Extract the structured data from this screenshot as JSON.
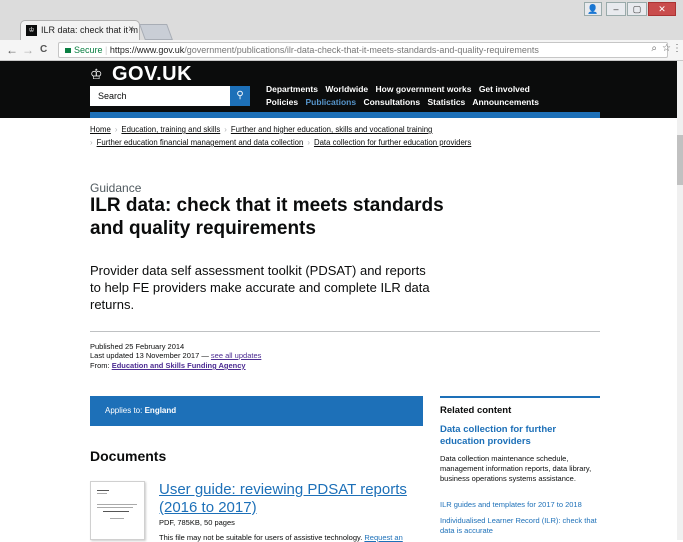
{
  "browser": {
    "tab_title": "ILR data: check that it m",
    "tab_close": "×",
    "favicon": "♔",
    "secure_label": "Secure",
    "url_host": "https://www.gov.uk",
    "url_path": "/government/publications/ilr-data-check-that-it-meets-standards-and-quality-requirements",
    "back": "←",
    "forward": "→",
    "reload": "C",
    "zoom_icon": "⌕",
    "star_icon": "☆",
    "menu_icon": "⋮",
    "win_user": "👤",
    "win_min": "–",
    "win_max": "▢",
    "win_close": "✕"
  },
  "header": {
    "crown": "♔",
    "logo": "GOV.UK",
    "search_placeholder": "Search",
    "search_icon": "🔍",
    "nav_row1": [
      "Departments",
      "Worldwide",
      "How government works",
      "Get involved"
    ],
    "nav_row2": [
      "Policies",
      "Publications",
      "Consultations",
      "Statistics",
      "Announcements"
    ],
    "active_nav": "Publications"
  },
  "breadcrumbs": {
    "row1": [
      "Home",
      "Education, training and skills",
      "Further and higher education, skills and vocational training"
    ],
    "row2": [
      "Further education financial management and data collection",
      "Data collection for further education providers"
    ],
    "separator": "›"
  },
  "page": {
    "label": "Guidance",
    "title": "ILR data: check that it meets standards and quality requirements",
    "summary": "Provider data self assessment toolkit (PDSAT) and reports to help FE providers make accurate and complete ILR data returns."
  },
  "meta": {
    "published": "Published 25 February 2014",
    "updated_prefix": "Last updated 13 November 2017 —",
    "updated_link": "see all updates",
    "from_prefix": "From:",
    "from_link": "Education and Skills Funding Agency"
  },
  "applies": {
    "prefix": "Applies to:",
    "value": "England"
  },
  "documents": {
    "heading": "Documents",
    "items": [
      {
        "title": "User guide: reviewing PDSAT reports (2016 to 2017)",
        "meta": "PDF, 785KB, 50 pages",
        "note_prefix": "This file may not be suitable for users of assistive technology.",
        "note_link": "Request an"
      }
    ]
  },
  "related": {
    "heading": "Related content",
    "main_link": "Data collection for further education providers",
    "main_desc": "Data collection maintenance schedule, management information reports, data library, business operations systems assistance.",
    "links": [
      "ILR guides and templates for 2017 to 2018",
      "Individualised Learner Record (ILR): check that data is accurate"
    ]
  },
  "colors": {
    "brand_black": "#0b0c0c",
    "link_blue": "#1d70b8",
    "visited_purple": "#4c2c92"
  }
}
